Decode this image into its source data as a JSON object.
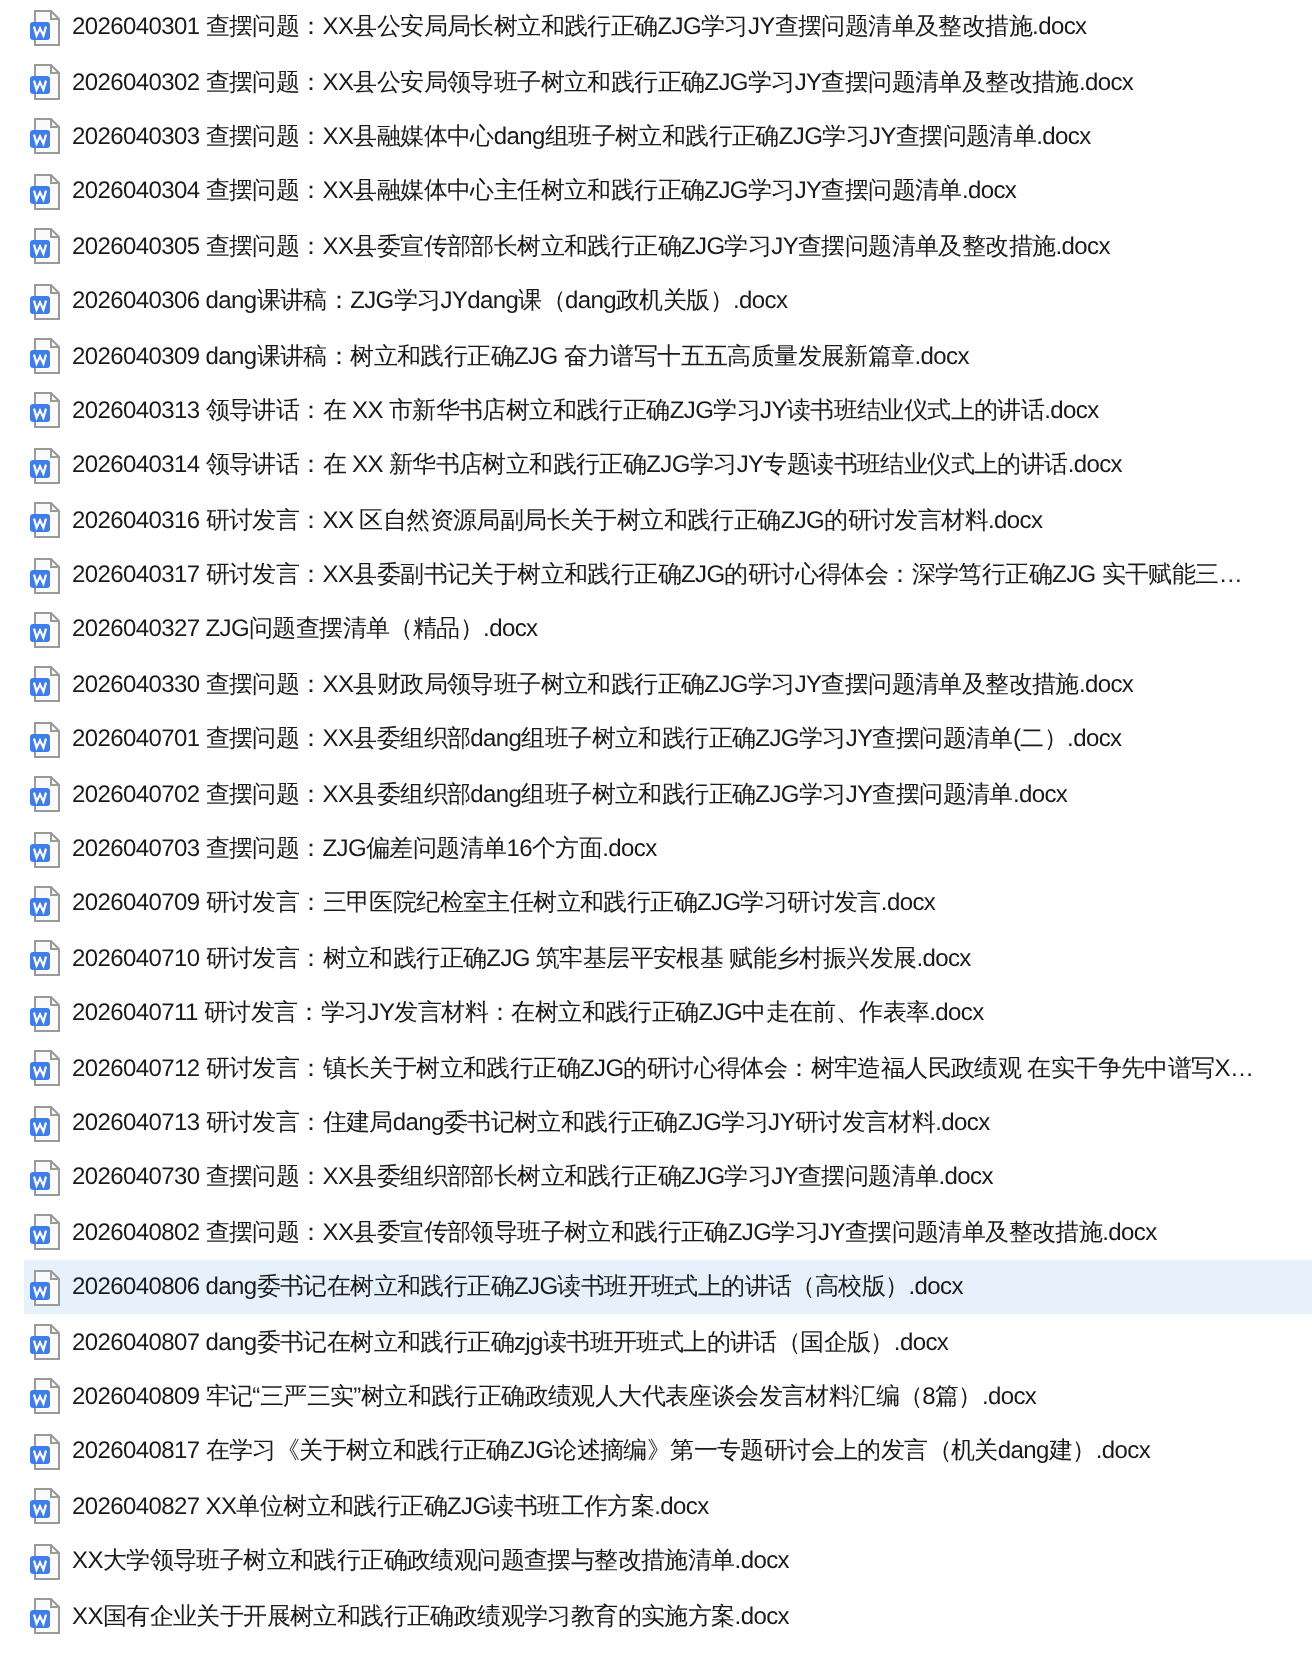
{
  "files": [
    {
      "name": "2026040301 查摆问题：XX县公安局局长树立和践行正确ZJG学习JY查摆问题清单及整改措施.docx",
      "selected": false
    },
    {
      "name": "2026040302 查摆问题：XX县公安局领导班子树立和践行正确ZJG学习JY查摆问题清单及整改措施.docx",
      "selected": false
    },
    {
      "name": "2026040303 查摆问题：XX县融媒体中心dang组班子树立和践行正确ZJG学习JY查摆问题清单.docx",
      "selected": false
    },
    {
      "name": "2026040304 查摆问题：XX县融媒体中心主任树立和践行正确ZJG学习JY查摆问题清单.docx",
      "selected": false
    },
    {
      "name": "2026040305 查摆问题：XX县委宣传部部长树立和践行正确ZJG学习JY查摆问题清单及整改措施.docx",
      "selected": false
    },
    {
      "name": "2026040306 dang课讲稿：ZJG学习JYdang课（dang政机关版）.docx",
      "selected": false
    },
    {
      "name": "2026040309 dang课讲稿：树立和践行正确ZJG 奋力谱写十五五高质量发展新篇章.docx",
      "selected": false
    },
    {
      "name": "2026040313 领导讲话：在 XX 市新华书店树立和践行正确ZJG学习JY读书班结业仪式上的讲话.docx",
      "selected": false
    },
    {
      "name": "2026040314 领导讲话：在 XX 新华书店树立和践行正确ZJG学习JY专题读书班结业仪式上的讲话.docx",
      "selected": false
    },
    {
      "name": "2026040316 研讨发言：XX 区自然资源局副局长关于树立和践行正确ZJG的研讨发言材料.docx",
      "selected": false
    },
    {
      "name": "2026040317 研讨发言：XX县委副书记关于树立和践行正确ZJG的研讨心得体会：深学笃行正确ZJG 实干赋能三…",
      "selected": false
    },
    {
      "name": "2026040327 ZJG问题查摆清单（精品）.docx",
      "selected": false
    },
    {
      "name": "2026040330 查摆问题：XX县财政局领导班子树立和践行正确ZJG学习JY查摆问题清单及整改措施.docx",
      "selected": false
    },
    {
      "name": "2026040701 查摆问题：XX县委组织部dang组班子树立和践行正确ZJG学习JY查摆问题清单(二）.docx",
      "selected": false
    },
    {
      "name": "2026040702 查摆问题：XX县委组织部dang组班子树立和践行正确ZJG学习JY查摆问题清单.docx",
      "selected": false
    },
    {
      "name": "2026040703 查摆问题：ZJG偏差问题清单16个方面.docx",
      "selected": false
    },
    {
      "name": "2026040709 研讨发言：三甲医院纪检室主任树立和践行正确ZJG学习研讨发言.docx",
      "selected": false
    },
    {
      "name": "2026040710 研讨发言：树立和践行正确ZJG 筑牢基层平安根基 赋能乡村振兴发展.docx",
      "selected": false
    },
    {
      "name": "2026040711 研讨发言：学习JY发言材料：在树立和践行正确ZJG中走在前、作表率.docx",
      "selected": false
    },
    {
      "name": "2026040712 研讨发言：镇长关于树立和践行正确ZJG的研讨心得体会：树牢造福人民政绩观 在实干争先中谱写X…",
      "selected": false
    },
    {
      "name": "2026040713 研讨发言：住建局dang委书记树立和践行正确ZJG学习JY研讨发言材料.docx",
      "selected": false
    },
    {
      "name": "2026040730 查摆问题：XX县委组织部部长树立和践行正确ZJG学习JY查摆问题清单.docx",
      "selected": false
    },
    {
      "name": "2026040802 查摆问题：XX县委宣传部领导班子树立和践行正确ZJG学习JY查摆问题清单及整改措施.docx",
      "selected": false
    },
    {
      "name": "2026040806 dang委书记在树立和践行正确ZJG读书班开班式上的讲话（高校版）.docx",
      "selected": true
    },
    {
      "name": "2026040807 dang委书记在树立和践行正确zjg读书班开班式上的讲话（国企版）.docx",
      "selected": false
    },
    {
      "name": "2026040809 牢记“三严三实”树立和践行正确政绩观人大代表座谈会发言材料汇编（8篇）.docx",
      "selected": false
    },
    {
      "name": "2026040817 在学习《关于树立和践行正确ZJG论述摘编》第一专题研讨会上的发言（机关dang建）.docx",
      "selected": false
    },
    {
      "name": "2026040827 XX单位树立和践行正确ZJG读书班工作方案.docx",
      "selected": false
    },
    {
      "name": "XX大学领导班子树立和践行正确政绩观问题查摆与整改措施清单.docx",
      "selected": false
    },
    {
      "name": "XX国有企业关于开展树立和践行正确政绩观学习教育的实施方案.docx",
      "selected": false
    }
  ]
}
